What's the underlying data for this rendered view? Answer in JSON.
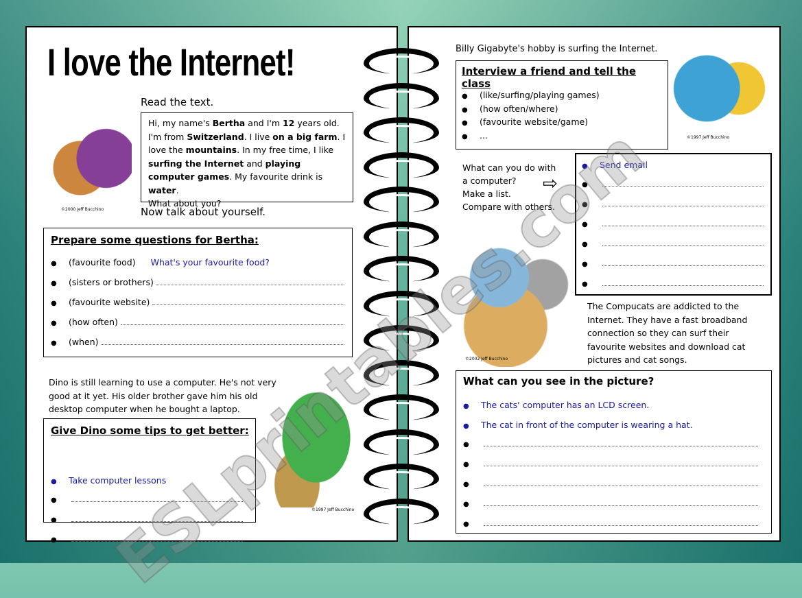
{
  "title": "I love the Internet!",
  "left": {
    "read_label": "Read the text.",
    "text_parts": [
      [
        "Hi, my name's ",
        0
      ],
      [
        "Bertha",
        1
      ],
      [
        " and I'm ",
        0
      ],
      [
        "12",
        1
      ],
      [
        " years old. I'm from ",
        0
      ],
      [
        "Switzerland",
        1
      ],
      [
        ". I live ",
        0
      ],
      [
        "on a big farm",
        1
      ],
      [
        ". I love the ",
        0
      ],
      [
        "mountains",
        1
      ],
      [
        ". In my free time, I like ",
        0
      ],
      [
        "surfing the Internet",
        1
      ],
      [
        " and ",
        0
      ],
      [
        "playing computer games",
        1
      ],
      [
        ". My favourite drink is ",
        0
      ],
      [
        "water",
        1
      ],
      [
        ".",
        0
      ]
    ],
    "text_end": "What about you?",
    "talk_label": "Now talk about yourself.",
    "questions": {
      "heading": "Prepare some questions for Bertha:",
      "items": [
        {
          "cue": "(favourite food)",
          "answer": "What's your favourite food?"
        },
        {
          "cue": "(sisters or brothers)",
          "answer": ""
        },
        {
          "cue": "(favourite website)",
          "answer": ""
        },
        {
          "cue": "(how often)",
          "answer": ""
        },
        {
          "cue": "(when)",
          "answer": ""
        }
      ]
    },
    "dino_text": "Dino is still learning to use a computer. He's not very good at it yet. His older brother gave him his old desktop computer when he bought a laptop.",
    "tips": {
      "heading": "Give Dino some tips to get better:",
      "items": [
        "Take computer lessons",
        "",
        "",
        ""
      ]
    },
    "credits": [
      "©2000 Jeff Bucchino",
      "©1997 Jeff Bucchino"
    ]
  },
  "right": {
    "billy_text": "Billy Gigabyte's hobby is surfing the Internet.",
    "interview": {
      "heading": "Interview a friend and tell the class",
      "items": [
        "(like/surfing/playing games)",
        "(how often/where)",
        "(favourite website/game)",
        "..."
      ]
    },
    "computer_prompt": [
      "What can you do with",
      "a computer?",
      "Make a list.",
      "Compare with others."
    ],
    "list_items": [
      "Send email",
      "",
      "",
      "",
      "",
      "",
      ""
    ],
    "compucats_text": "The Compucats are addicted to the Internet. They have a fast broadband connection so they can surf their favourite websites and download cat pictures and cat songs.",
    "picture": {
      "heading": "What can you see in the picture?",
      "items": [
        "The cats' computer has an LCD screen.",
        "The cat in front of the computer is wearing a hat.",
        "",
        "",
        "",
        "",
        ""
      ]
    },
    "credits": [
      "©1997 Jeff Bucchino",
      "©2002 Jeff Bucchino"
    ]
  },
  "watermark": "ESLprintables.com",
  "colors": {
    "answer_blue": "#1a1aa0"
  }
}
